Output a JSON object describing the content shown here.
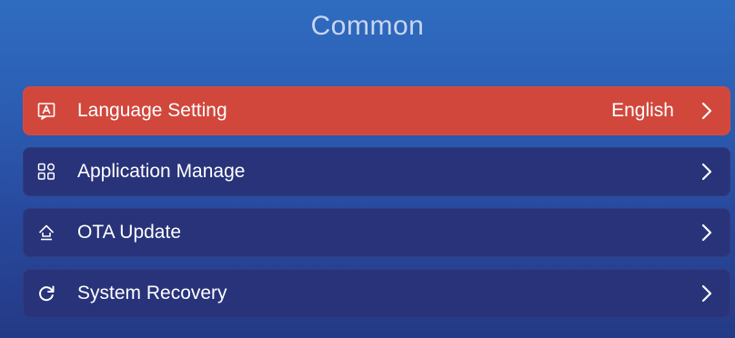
{
  "header": {
    "title": "Common"
  },
  "menu": {
    "items": [
      {
        "label": "Language Setting",
        "value": "English",
        "icon": "language-icon",
        "active": true
      },
      {
        "label": "Application Manage",
        "value": "",
        "icon": "grid-icon",
        "active": false
      },
      {
        "label": "OTA Update",
        "value": "",
        "icon": "upload-arrow-icon",
        "active": false
      },
      {
        "label": "System Recovery",
        "value": "",
        "icon": "refresh-icon",
        "active": false
      }
    ]
  },
  "colors": {
    "active_item": "#d1473c",
    "item_background": "#28337a",
    "background_top": "#2f6cc0",
    "background_bottom": "#243a86",
    "title_text": "#c9d6ee"
  }
}
